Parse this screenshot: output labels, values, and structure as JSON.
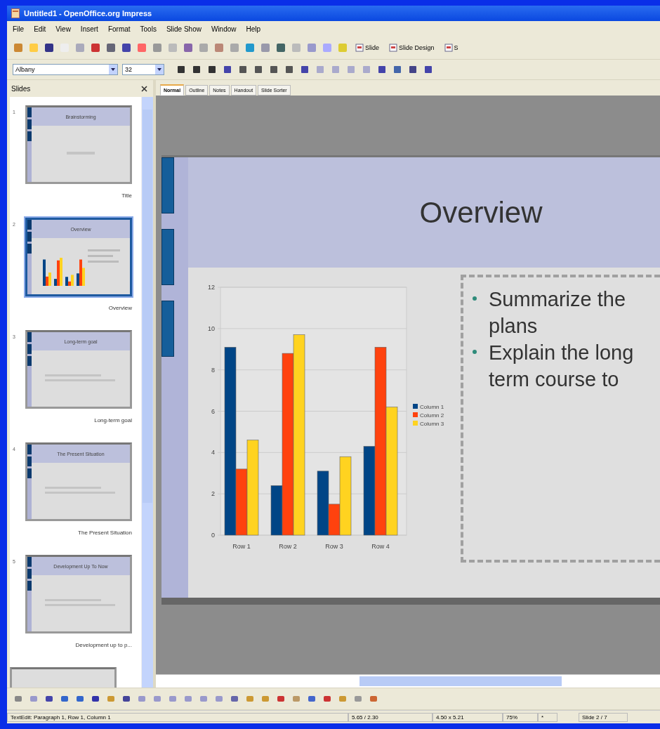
{
  "window": {
    "title": "Untitled1 - OpenOffice.org Impress"
  },
  "menu": [
    "File",
    "Edit",
    "View",
    "Insert",
    "Format",
    "Tools",
    "Slide Show",
    "Window",
    "Help"
  ],
  "toolbar": {
    "buttons": [
      "Slide",
      "Slide Design",
      "S"
    ]
  },
  "formatting": {
    "font": "Albany",
    "size": "32"
  },
  "view_tabs": [
    {
      "label": "Normal",
      "selected": true
    },
    {
      "label": "Outline",
      "selected": false
    },
    {
      "label": "Notes",
      "selected": false
    },
    {
      "label": "Handout",
      "selected": false
    },
    {
      "label": "Slide Sorter",
      "selected": false
    }
  ],
  "slides_pane": {
    "title": "Slides"
  },
  "slides": [
    {
      "number": "1",
      "name": "Title",
      "title": "Brainstorming",
      "kind": "title",
      "selected": false
    },
    {
      "number": "2",
      "name": "Overview",
      "title": "Overview",
      "kind": "chart",
      "selected": true
    },
    {
      "number": "3",
      "name": "Long-term goal",
      "title": "Long-term goal",
      "kind": "text",
      "selected": false
    },
    {
      "number": "4",
      "name": "The Present Situation",
      "title": "The Present Situation",
      "kind": "text",
      "selected": false
    },
    {
      "number": "5",
      "name": "Development up to p...",
      "title": "Development Up To Now",
      "kind": "text",
      "selected": false
    }
  ],
  "slide": {
    "title": "Overview",
    "bullets": [
      {
        "lines": [
          "Summarize the",
          "plans"
        ]
      },
      {
        "lines": [
          "Explain the long",
          "term course to"
        ]
      }
    ],
    "chart_data": {
      "type": "bar",
      "categories": [
        "Row 1",
        "Row 2",
        "Row 3",
        "Row 4"
      ],
      "series": [
        {
          "name": "Column 1",
          "color": "#004586",
          "values": [
            9.1,
            2.4,
            3.1,
            4.3
          ]
        },
        {
          "name": "Column 2",
          "color": "#ff420e",
          "values": [
            3.2,
            8.8,
            1.5,
            9.1
          ]
        },
        {
          "name": "Column 3",
          "color": "#ffd320",
          "values": [
            4.6,
            9.7,
            3.8,
            6.2
          ]
        }
      ],
      "ylim": [
        0,
        12
      ],
      "yticks": [
        0,
        2,
        4,
        6,
        8,
        10,
        12
      ],
      "grid": true,
      "legend": true
    }
  },
  "status_bar": [
    "TextEdit: Paragraph 1, Row 1, Column 1",
    "5.65 / 2.30",
    "4.50 x 5.21",
    "75%",
    "*",
    "Slide 2 / 7"
  ]
}
